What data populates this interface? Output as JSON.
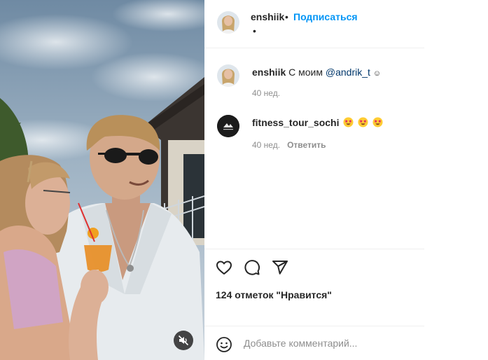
{
  "post": {
    "author": "enshiik",
    "separator_dot": "•",
    "follow_label": "Подписаться",
    "sub_dot": "•"
  },
  "caption": {
    "username": "enshiik",
    "text": "С моим",
    "mention": "@andrik_t",
    "emoji": "☺",
    "time": "40 нед."
  },
  "comments": [
    {
      "username": "fitness_tour_sochi",
      "emoji_count": 3,
      "time": "40 нед.",
      "reply_label": "Ответить"
    }
  ],
  "actions": {
    "icons": [
      "heart-icon",
      "comment-icon",
      "share-icon"
    ]
  },
  "likes_text": "124 отметок \"Нравится\"",
  "add_comment": {
    "placeholder": "Добавьте комментарий..."
  },
  "media": {
    "muted": true,
    "icon": "speaker-muted-icon"
  }
}
